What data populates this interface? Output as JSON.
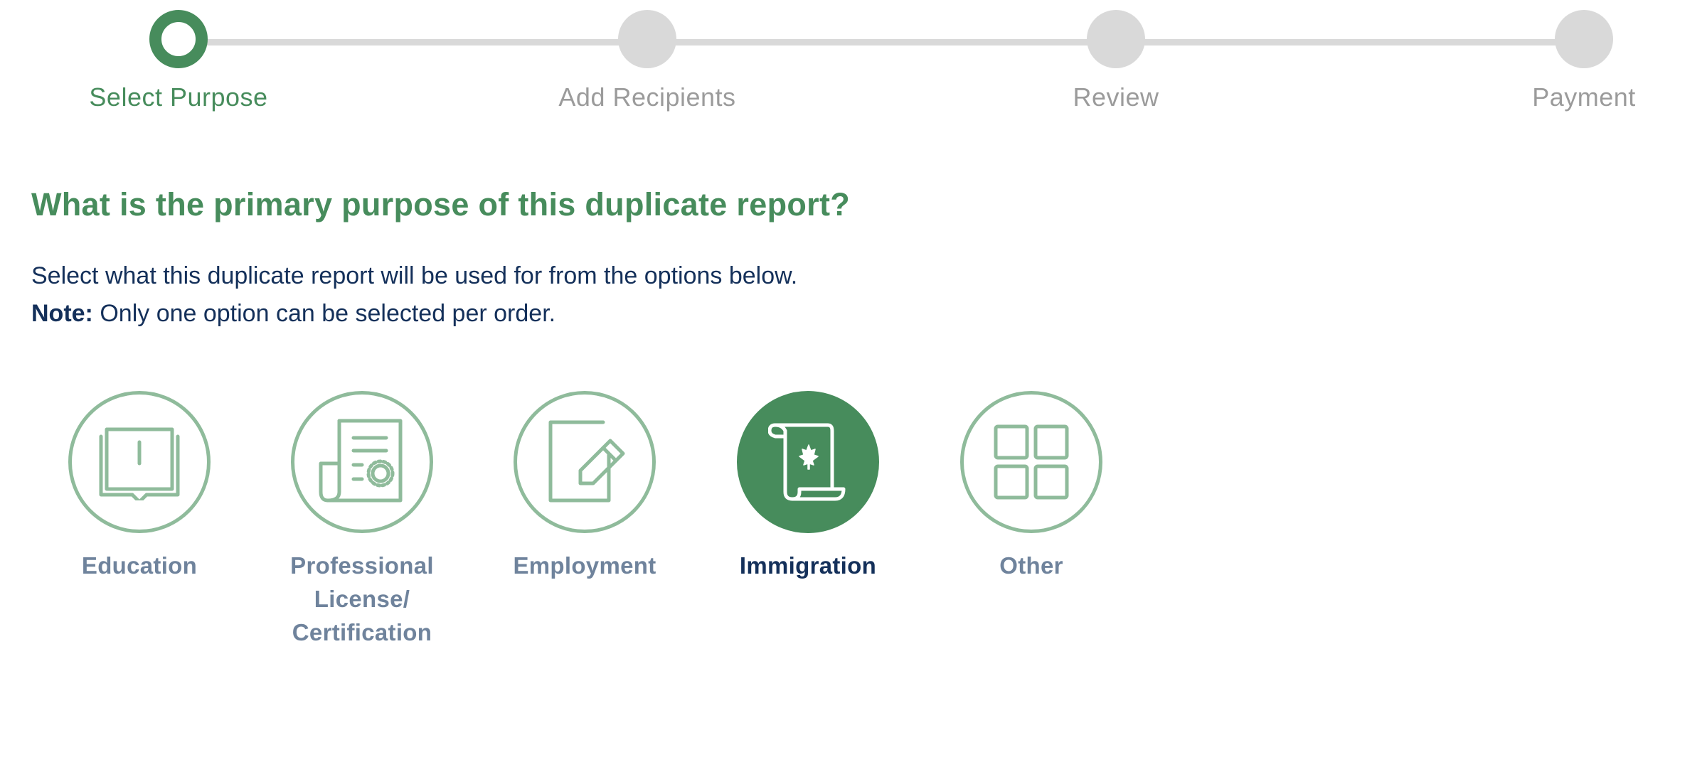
{
  "stepper": {
    "steps": [
      {
        "label": "Select Purpose",
        "state": "active"
      },
      {
        "label": "Add Recipients",
        "state": "upcoming"
      },
      {
        "label": "Review",
        "state": "upcoming"
      },
      {
        "label": "Payment",
        "state": "upcoming"
      }
    ]
  },
  "question": {
    "title": "What is the primary purpose of this duplicate report?",
    "description": "Select what this duplicate report will be used for from the options below.",
    "note_label": "Note:",
    "note_text": " Only one option can be selected per order."
  },
  "options": [
    {
      "label": "Education",
      "icon": "open-book-icon",
      "selected": false
    },
    {
      "label": "Professional License/ Certification",
      "label_lines": [
        "Professional",
        "License/",
        "Certification"
      ],
      "icon": "certificate-document-icon",
      "selected": false
    },
    {
      "label": "Employment",
      "icon": "edit-document-icon",
      "selected": false
    },
    {
      "label": "Immigration",
      "icon": "scroll-maple-leaf-icon",
      "selected": true
    },
    {
      "label": "Other",
      "icon": "grid-icon",
      "selected": false
    }
  ],
  "colors": {
    "accent_green": "#478c5c",
    "muted_green": "#8fbb9b",
    "inactive_gray": "#d9d9d9",
    "label_gray": "#9b9b9b",
    "navy_text": "#14305a",
    "option_label_gray": "#6f839c"
  }
}
